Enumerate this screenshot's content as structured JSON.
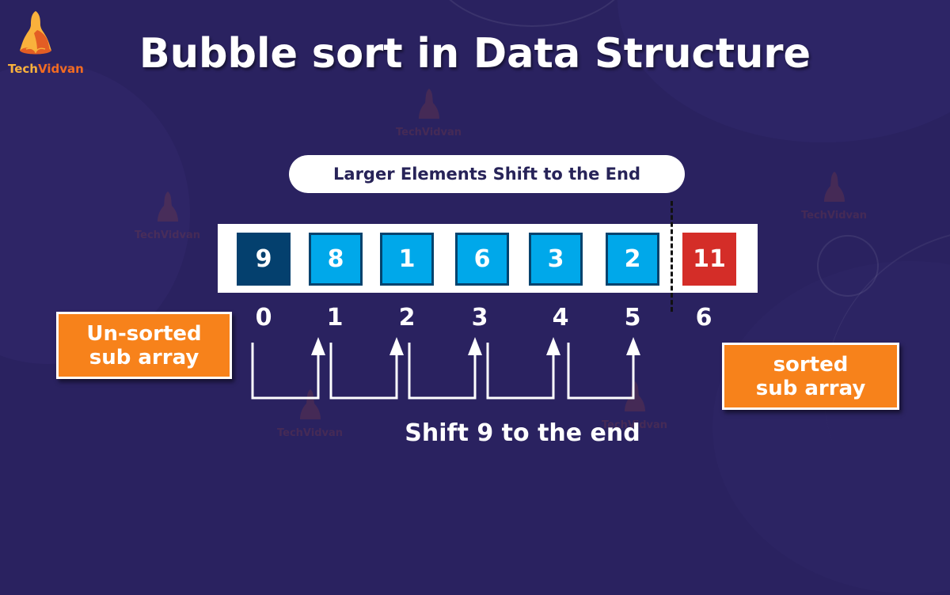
{
  "brand": {
    "name_part1": "Tech",
    "name_part2": "Vidvan"
  },
  "title": "Bubble sort in Data Structure",
  "subtitle_pill": "Larger Elements Shift to the End",
  "array": [
    {
      "value": "9",
      "index": "0",
      "state": "current"
    },
    {
      "value": "8",
      "index": "1",
      "state": "unsorted"
    },
    {
      "value": "1",
      "index": "2",
      "state": "unsorted"
    },
    {
      "value": "6",
      "index": "3",
      "state": "unsorted"
    },
    {
      "value": "3",
      "index": "4",
      "state": "unsorted"
    },
    {
      "value": "2",
      "index": "5",
      "state": "unsorted"
    },
    {
      "value": "11",
      "index": "6",
      "state": "sorted"
    }
  ],
  "labels": {
    "unsorted_line1": "Un-sorted",
    "unsorted_line2": "sub array",
    "sorted_line1": "sorted",
    "sorted_line2": "sub array"
  },
  "caption": "Shift 9 to the end",
  "colors": {
    "background": "#2a2260",
    "current": "#04406e",
    "unsorted": "#00a8ea",
    "sorted": "#d42d28",
    "label_box": "#f7821b",
    "pill_text": "#272358"
  }
}
